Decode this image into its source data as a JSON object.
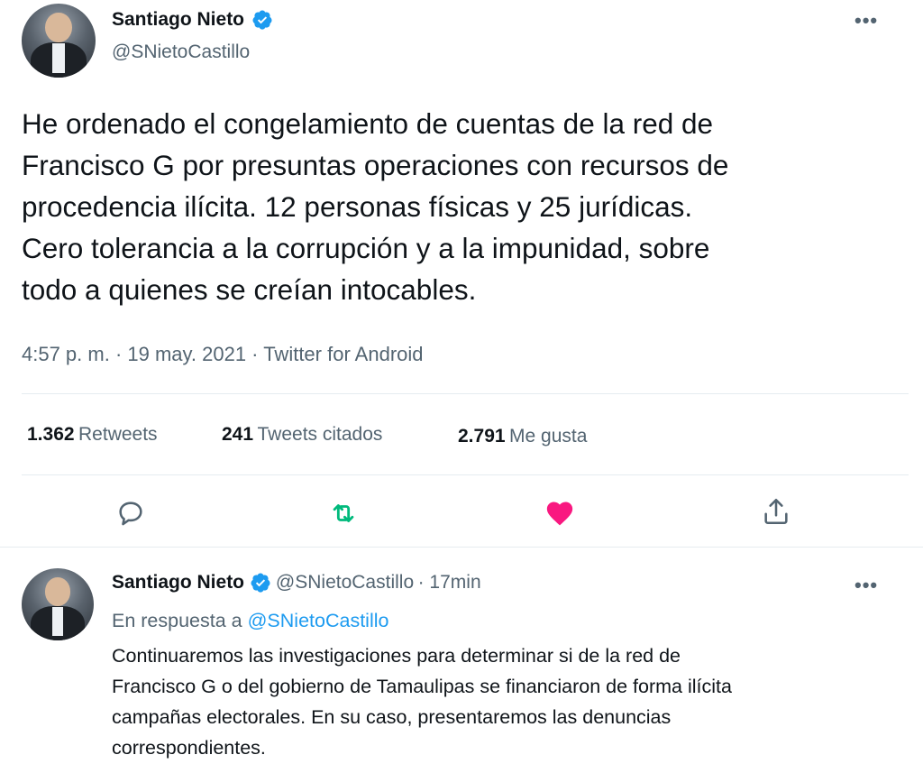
{
  "main_tweet": {
    "author_name": "Santiago Nieto",
    "author_handle": "@SNietoCastillo",
    "more_icon": "more-icon",
    "text_lines": [
      "He ordenado el congelamiento de cuentas de la red de",
      "Francisco G por presuntas operaciones con recursos de",
      "procedencia ilícita. 12 personas físicas y 25 jurídicas.",
      "Cero tolerancia a la corrupción y a la impunidad, sobre",
      "todo a quienes se creían intocables."
    ],
    "timestamp": "4:57 p. m. · 19 may. 2021 · Twitter for Android",
    "stats": {
      "retweets_count": "1.362",
      "retweets_label": "Retweets",
      "quotes_count": "241",
      "quotes_label": "Tweets citados",
      "likes_count": "2.791",
      "likes_label": "Me gusta"
    },
    "actions": {
      "reply_icon": "reply-icon",
      "retweet_icon": "retweet-icon",
      "like_icon": "heart-icon",
      "share_icon": "share-icon"
    }
  },
  "reply_tweet": {
    "author_name": "Santiago Nieto",
    "author_handle": "@SNietoCastillo",
    "time": "· 17min",
    "replying_to_label": "En respuesta a",
    "replying_to_handle": "@SNietoCastillo",
    "text_lines": [
      "Continuaremos las investigaciones para determinar si de la red de",
      "Francisco G o del gobierno de Tamaulipas se financiaron de forma ilícita",
      "campañas electorales. En su caso, presentaremos las denuncias",
      "correspondientes."
    ]
  },
  "colors": {
    "accent": "#1d9bf0",
    "retweet_green": "#00ba7c",
    "like_red": "#f91880",
    "secondary_text": "#536471"
  }
}
